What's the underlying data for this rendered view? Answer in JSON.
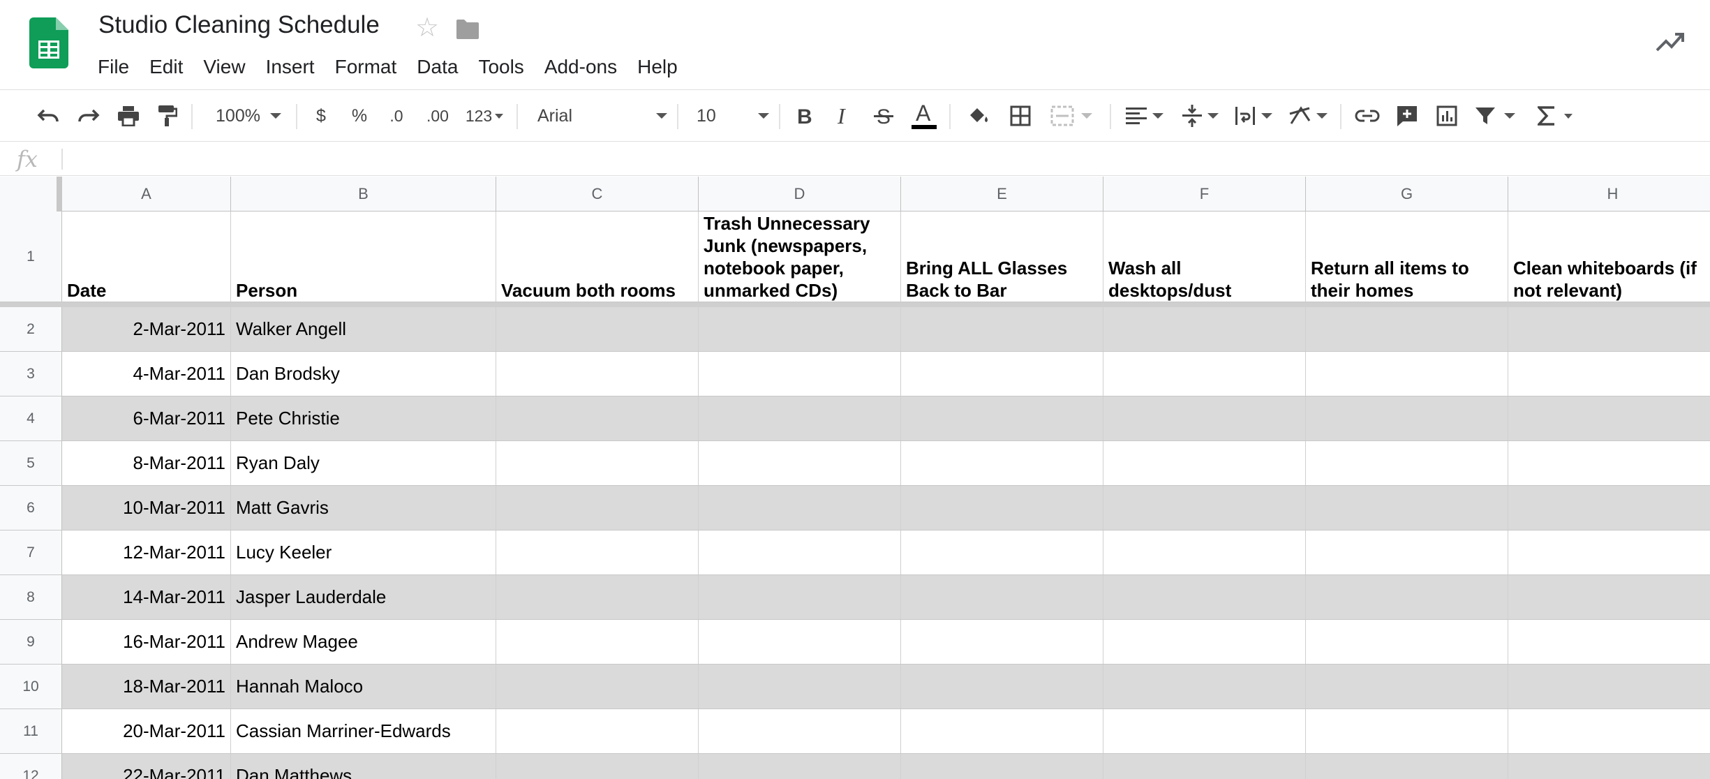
{
  "app": {
    "title": "Studio Cleaning Schedule",
    "menu": [
      "File",
      "Edit",
      "View",
      "Insert",
      "Format",
      "Data",
      "Tools",
      "Add-ons",
      "Help"
    ]
  },
  "toolbar": {
    "zoom": "100%",
    "currency": "$",
    "percent": "%",
    "decrease_decimals": ".0",
    "increase_decimals": ".00",
    "more_formats": "123",
    "font": "Arial",
    "font_size": "10"
  },
  "formula_bar": {
    "label": "fx",
    "value": ""
  },
  "sheet": {
    "columns": [
      "A",
      "B",
      "C",
      "D",
      "E",
      "F",
      "G",
      "H"
    ],
    "header_row": {
      "number": "1",
      "cells": [
        "Date",
        "Person",
        "Vacuum both rooms",
        "Trash Unnecessary Junk (newspapers, notebook paper, unmarked CDs)",
        "Bring ALL Glasses Back to Bar",
        "Wash all desktops/dust",
        "Return all items to their homes",
        "Clean whiteboards (if not relevant)"
      ]
    },
    "rows": [
      {
        "number": "2",
        "date": "2-Mar-2011",
        "person": "Walker Angell"
      },
      {
        "number": "3",
        "date": "4-Mar-2011",
        "person": "Dan Brodsky"
      },
      {
        "number": "4",
        "date": "6-Mar-2011",
        "person": "Pete Christie"
      },
      {
        "number": "5",
        "date": "8-Mar-2011",
        "person": "Ryan Daly"
      },
      {
        "number": "6",
        "date": "10-Mar-2011",
        "person": "Matt Gavris"
      },
      {
        "number": "7",
        "date": "12-Mar-2011",
        "person": "Lucy Keeler"
      },
      {
        "number": "8",
        "date": "14-Mar-2011",
        "person": "Jasper Lauderdale"
      },
      {
        "number": "9",
        "date": "16-Mar-2011",
        "person": "Andrew Magee"
      },
      {
        "number": "10",
        "date": "18-Mar-2011",
        "person": "Hannah Maloco"
      },
      {
        "number": "11",
        "date": "20-Mar-2011",
        "person": "Cassian Marriner-Edwards"
      },
      {
        "number": "12",
        "date": "22-Mar-2011",
        "person": "Dan Matthews"
      }
    ]
  },
  "colors": {
    "sheets_green": "#0f9d58",
    "shaded_row": "#dadada",
    "header_bg": "#f8f9fa"
  }
}
